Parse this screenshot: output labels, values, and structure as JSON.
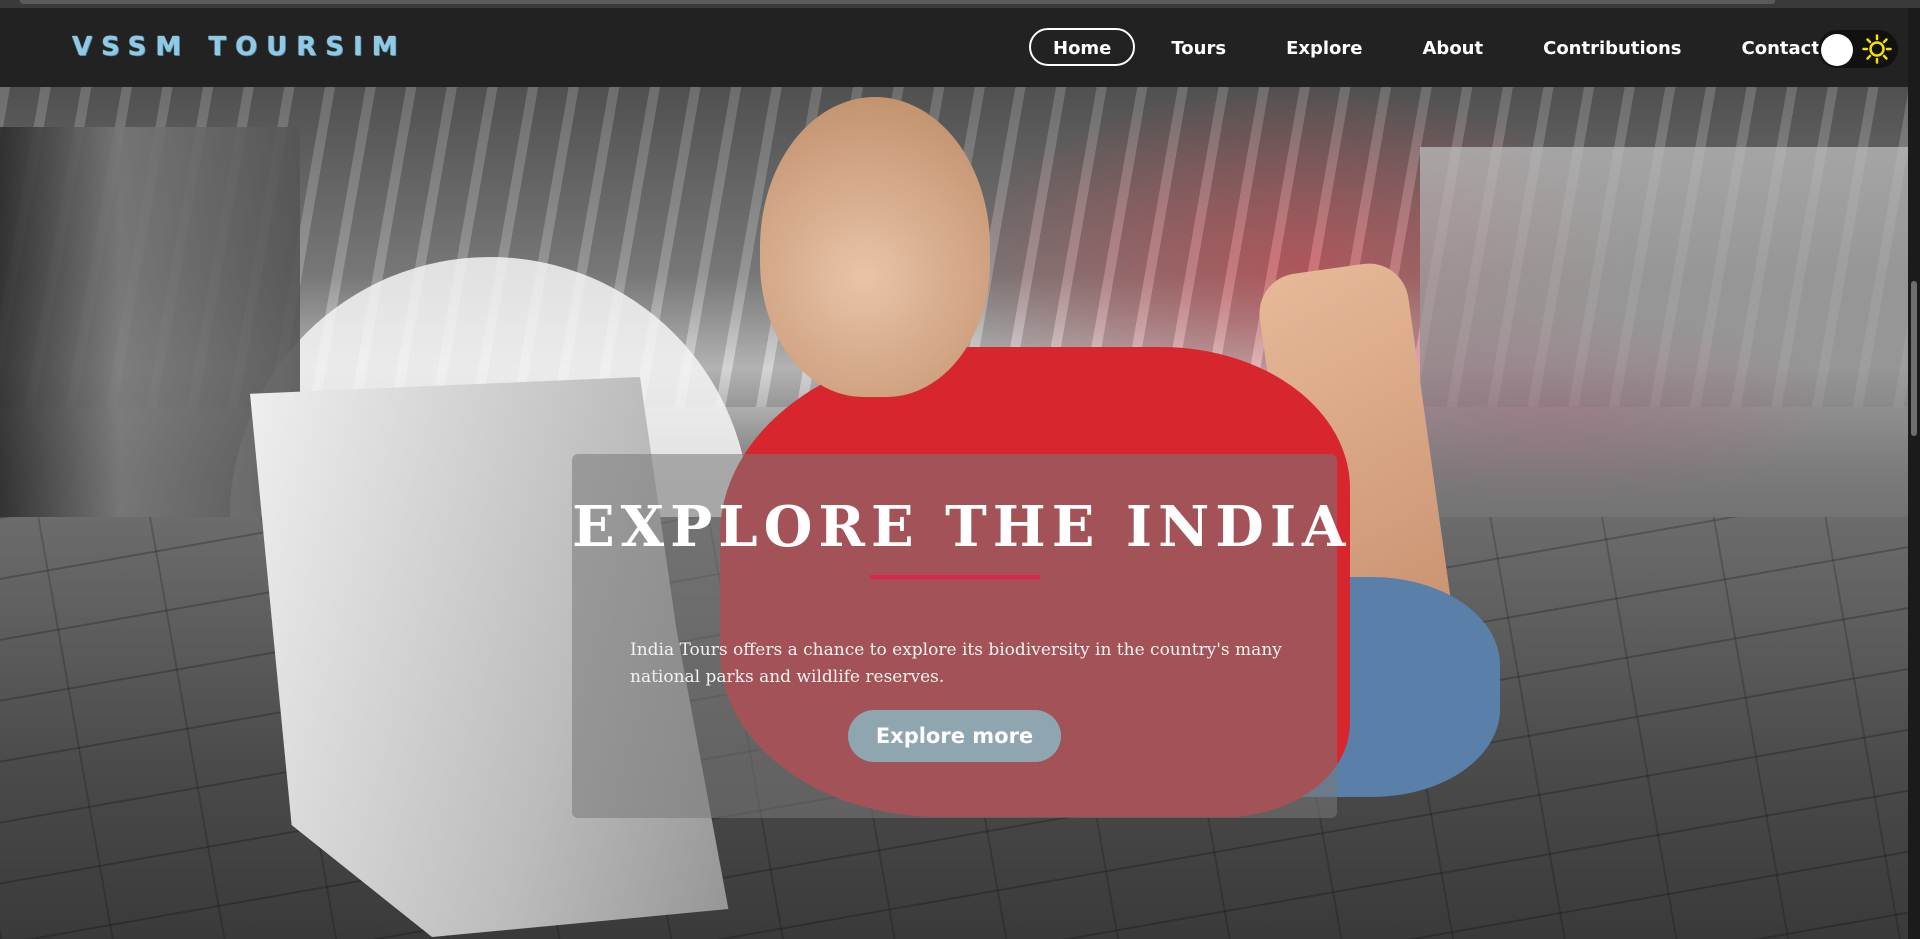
{
  "navbar": {
    "brand": "VSSM TOURSIM",
    "links": [
      {
        "label": "Home",
        "active": true
      },
      {
        "label": "Tours",
        "active": false
      },
      {
        "label": "Explore",
        "active": false
      },
      {
        "label": "About",
        "active": false
      },
      {
        "label": "Contributions",
        "active": false
      },
      {
        "label": "Contact",
        "active": false
      }
    ],
    "theme_toggle": {
      "icon": "sun-icon",
      "state": "light"
    }
  },
  "hero": {
    "title": "EXPLORE THE INDIA",
    "description": "India Tours offers a chance to explore its biodiversity in the country's many national parks and wildlife reserves.",
    "button_label": "Explore more"
  },
  "colors": {
    "navbar_bg": "#222222",
    "brand": "#8ecae6",
    "accent_divider": "#e0244f",
    "button_bg": "#8fa5b0",
    "sun_icon": "#f5e000"
  }
}
